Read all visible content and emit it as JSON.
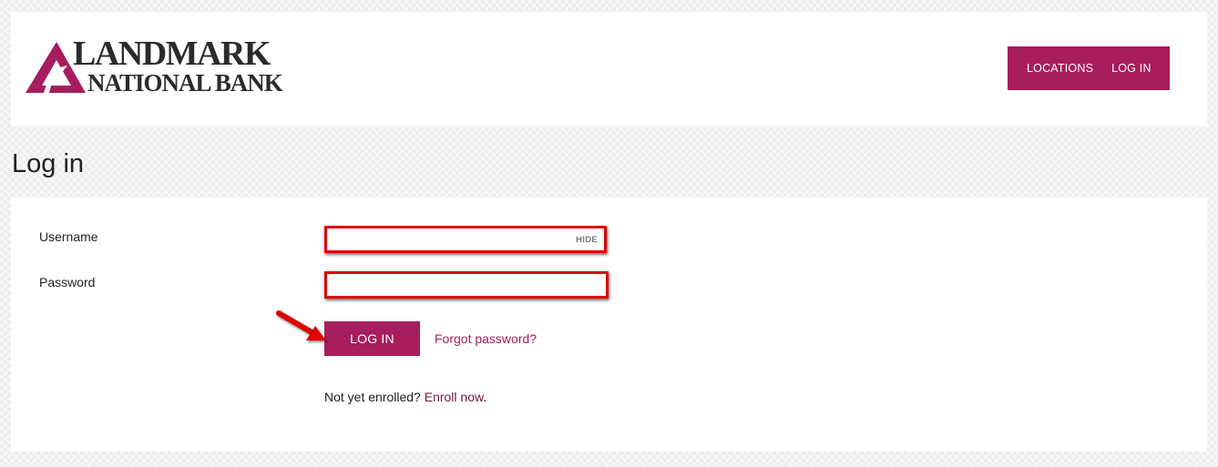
{
  "brand": {
    "line1": "LANDMARK",
    "line2": "NATIONAL BANK",
    "color": "#a71d5d"
  },
  "nav": {
    "items": [
      {
        "label": "LOCATIONS"
      },
      {
        "label": "LOG IN"
      }
    ]
  },
  "page": {
    "title": "Log in"
  },
  "form": {
    "username_label": "Username",
    "username_value": "",
    "hide_label": "HIDE",
    "password_label": "Password",
    "password_value": "",
    "login_button": "LOG IN",
    "forgot_link": "Forgot password?",
    "enroll_prefix": "Not yet enrolled?",
    "enroll_link": "Enroll now",
    "enroll_suffix": "."
  },
  "colors": {
    "accent": "#a71d5d",
    "highlight": "#e00000"
  }
}
